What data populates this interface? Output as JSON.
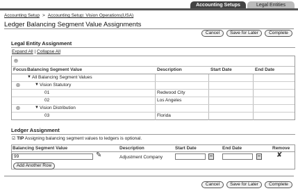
{
  "tabs": [
    {
      "label": "Accounting Setups",
      "active": true
    },
    {
      "label": "Legal Entities",
      "active": false
    }
  ],
  "breadcrumb": {
    "items": [
      "Accounting Setup",
      "Accounting Setup: Vision Operations(USA)"
    ],
    "separator": ">"
  },
  "page_title": "Ledger Balancing Segment Value Assignments",
  "buttons": {
    "cancel": "Cancel",
    "save_for_later": "Save for Later",
    "complete": "Complete"
  },
  "legal_entity_assignment": {
    "title": "Legal Entity Assignment",
    "expand_all": "Expand All",
    "collapse_all": "Collapse All",
    "link_separator": "|",
    "columns": [
      "Focus",
      "Balancing Segment Value",
      "Description",
      "Start Date",
      "End Date"
    ],
    "rows": [
      {
        "focus": false,
        "level": 0,
        "toggle": true,
        "value": "All Balancing Segment Values",
        "description": "",
        "start_date": "",
        "end_date": ""
      },
      {
        "focus": true,
        "level": 1,
        "toggle": true,
        "value": "Vision Statutory",
        "description": "",
        "start_date": "",
        "end_date": ""
      },
      {
        "focus": false,
        "level": 2,
        "toggle": false,
        "value": "01",
        "description": "Redwood City",
        "start_date": "",
        "end_date": ""
      },
      {
        "focus": false,
        "level": 2,
        "toggle": false,
        "value": "02",
        "description": "Los Angeles",
        "start_date": "",
        "end_date": ""
      },
      {
        "focus": true,
        "level": 1,
        "toggle": true,
        "value": "Vision Distribution",
        "description": "",
        "start_date": "",
        "end_date": ""
      },
      {
        "focus": false,
        "level": 2,
        "toggle": false,
        "value": "03",
        "description": "Florida",
        "start_date": "",
        "end_date": ""
      }
    ]
  },
  "ledger_assignment": {
    "title": "Ledger Assignment",
    "tip_label": "TIP",
    "tip_text": "Assigning balancing segment values to ledgers is optional.",
    "columns": [
      "Balancing Segment Value",
      "Description",
      "Start Date",
      "End Date",
      "Remove"
    ],
    "row": {
      "value": "99",
      "description": "Adjustment Company",
      "start_date": "",
      "end_date": ""
    },
    "add_row_label": "Add Another Row"
  }
}
